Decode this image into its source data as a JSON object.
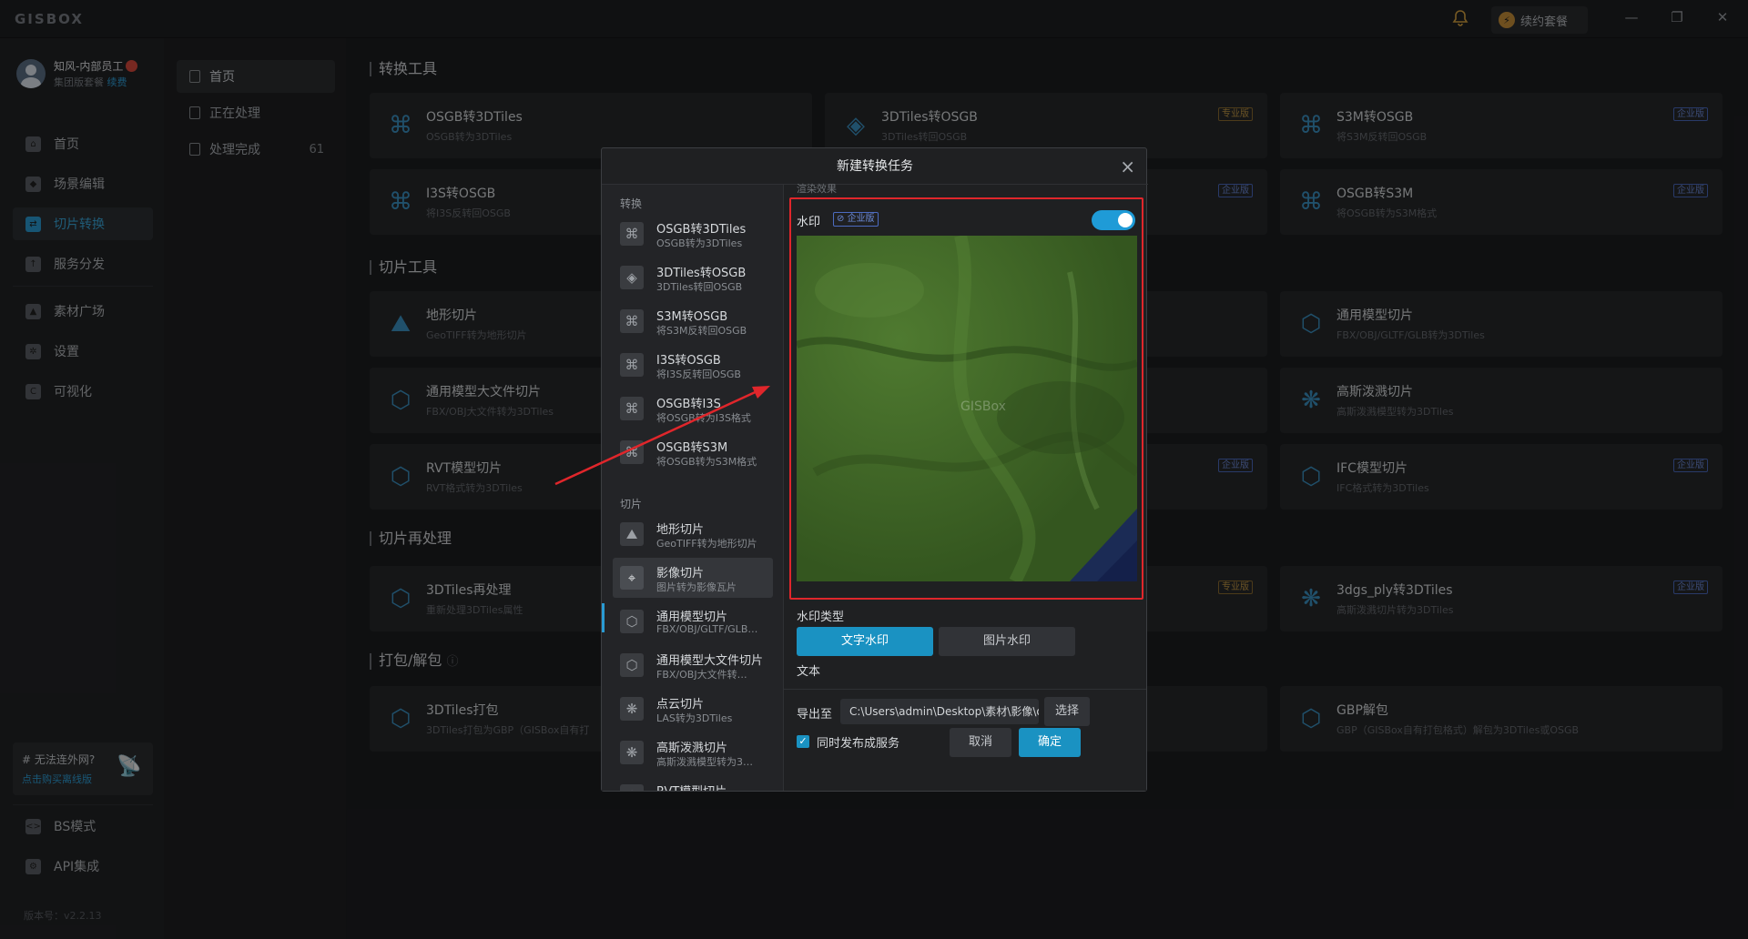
{
  "app": {
    "logo": "GISBOX",
    "renew_label": "续约套餐",
    "renew_icon": "lightning-icon"
  },
  "user": {
    "name": "知风-内部员工",
    "plan": "集团版套餐",
    "plan_link": "续费"
  },
  "sidebar": {
    "items": [
      {
        "label": "首页",
        "icon": "home-icon"
      },
      {
        "label": "场景编辑",
        "icon": "cube-icon"
      },
      {
        "label": "切片转换",
        "icon": "convert-icon",
        "active": true
      },
      {
        "label": "服务分发",
        "icon": "upload-icon"
      },
      {
        "label": "素材广场",
        "icon": "image-icon"
      },
      {
        "label": "设置",
        "icon": "gear-icon"
      },
      {
        "label": "可视化",
        "icon": "visual-icon"
      }
    ],
    "promo_title": "# 无法连外网?",
    "promo_link": "点击购买离线版",
    "bottom": [
      {
        "label": "BS模式",
        "icon": "code-icon"
      },
      {
        "label": "API集成",
        "icon": "api-icon"
      }
    ],
    "version": "版本号：v2.2.13"
  },
  "subnav": {
    "items": [
      {
        "label": "首页"
      },
      {
        "label": "正在处理"
      },
      {
        "label": "处理完成",
        "count": "61"
      }
    ]
  },
  "sections": {
    "convert": "转换工具",
    "slice": "切片工具",
    "reprocess": "切片再处理",
    "pack": "打包/解包"
  },
  "cards": [
    {
      "title": "OSGB转3DTiles",
      "sub": "OSGB转为3DTiles"
    },
    {
      "title": "3DTiles转OSGB",
      "sub": "3DTiles转回OSGB",
      "tag": "专业版"
    },
    {
      "title": "S3M转OSGB",
      "sub": "将S3M反转回OSGB",
      "tag": "企业版"
    },
    {
      "title": "I3S转OSGB",
      "sub": "将I3S反转回OSGB"
    },
    {
      "title": "",
      "sub": "",
      "tag": "企业版"
    },
    {
      "title": "OSGB转S3M",
      "sub": "将OSGB转为S3M格式",
      "tag": "企业版"
    },
    {
      "title": "地形切片",
      "sub": "GeoTIFF转为地形切片"
    },
    {
      "title": "通用模型切片",
      "sub": "FBX/OBJ/GLTF/GLB转为3DTiles"
    },
    {
      "title": "通用模型大文件切片",
      "sub": "FBX/OBJ大文件转为3DTiles"
    },
    {
      "title": "高斯泼溅切片",
      "sub": "高斯泼溅模型转为3DTiles"
    },
    {
      "title": "RVT模型切片",
      "sub": "RVT格式转为3DTiles"
    },
    {
      "title": "",
      "sub": "",
      "tag": "企业版"
    },
    {
      "title": "IFC模型切片",
      "sub": "IFC格式转为3DTiles",
      "tag": "企业版"
    },
    {
      "title": "3DTiles再处理",
      "sub": "重新处理3DTiles属性"
    },
    {
      "title": "",
      "sub": "",
      "tag": "专业版"
    },
    {
      "title": "3dgs_ply转3DTiles",
      "sub": "高斯泼溅切片转为3DTiles",
      "tag": "企业版"
    },
    {
      "title": "3DTiles打包",
      "sub": "3DTiles打包为GBP（GISBox自有打"
    },
    {
      "title": "GBP解包",
      "sub": "GBP（GISBox自有打包格式）解包为3DTiles或OSGB"
    }
  ],
  "dialog": {
    "title": "新建转换任务",
    "group_convert": "转换",
    "group_slice": "切片",
    "list": [
      {
        "title": "OSGB转3DTiles",
        "sub": "OSGB转为3DTiles"
      },
      {
        "title": "3DTiles转OSGB",
        "sub": "3DTiles转回OSGB"
      },
      {
        "title": "S3M转OSGB",
        "sub": "将S3M反转回OSGB"
      },
      {
        "title": "I3S转OSGB",
        "sub": "将I3S反转回OSGB"
      },
      {
        "title": "OSGB转I3S",
        "sub": "将OSGB转为I3S格式"
      },
      {
        "title": "OSGB转S3M",
        "sub": "将OSGB转为S3M格式"
      },
      {
        "title": "地形切片",
        "sub": "GeoTIFF转为地形切片"
      },
      {
        "title": "影像切片",
        "sub": "图片转为影像瓦片",
        "active": true
      },
      {
        "title": "通用模型切片",
        "sub": "FBX/OBJ/GLTF/GLB…"
      },
      {
        "title": "通用模型大文件切片",
        "sub": "FBX/OBJ大文件转…"
      },
      {
        "title": "点云切片",
        "sub": "LAS转为3DTiles"
      },
      {
        "title": "高斯泼溅切片",
        "sub": "高斯泼溅模型转为3…"
      },
      {
        "title": "RVT模型切片",
        "sub": ""
      }
    ],
    "render_label": "渲染效果",
    "watermark_label": "水印",
    "watermark_tag": "企业版",
    "watermark_enabled": true,
    "watermark_preview_text": "GISBox",
    "wm_type_label": "水印类型",
    "wm_text_btn": "文字水印",
    "wm_image_btn": "图片水印",
    "text_label": "文本",
    "export_label": "导出至",
    "export_path": "C:\\Users\\admin\\Desktop\\素材\\影像\\out…",
    "select_btn": "选择",
    "publish_label": "同时发布成服务",
    "publish_checked": true,
    "cancel_btn": "取消",
    "confirm_btn": "确定"
  },
  "colors": {
    "accent": "#1a92c2",
    "highlight_box": "#e0262b",
    "tag_pro": "#c59a45",
    "tag_ent": "#6d8bd9"
  }
}
